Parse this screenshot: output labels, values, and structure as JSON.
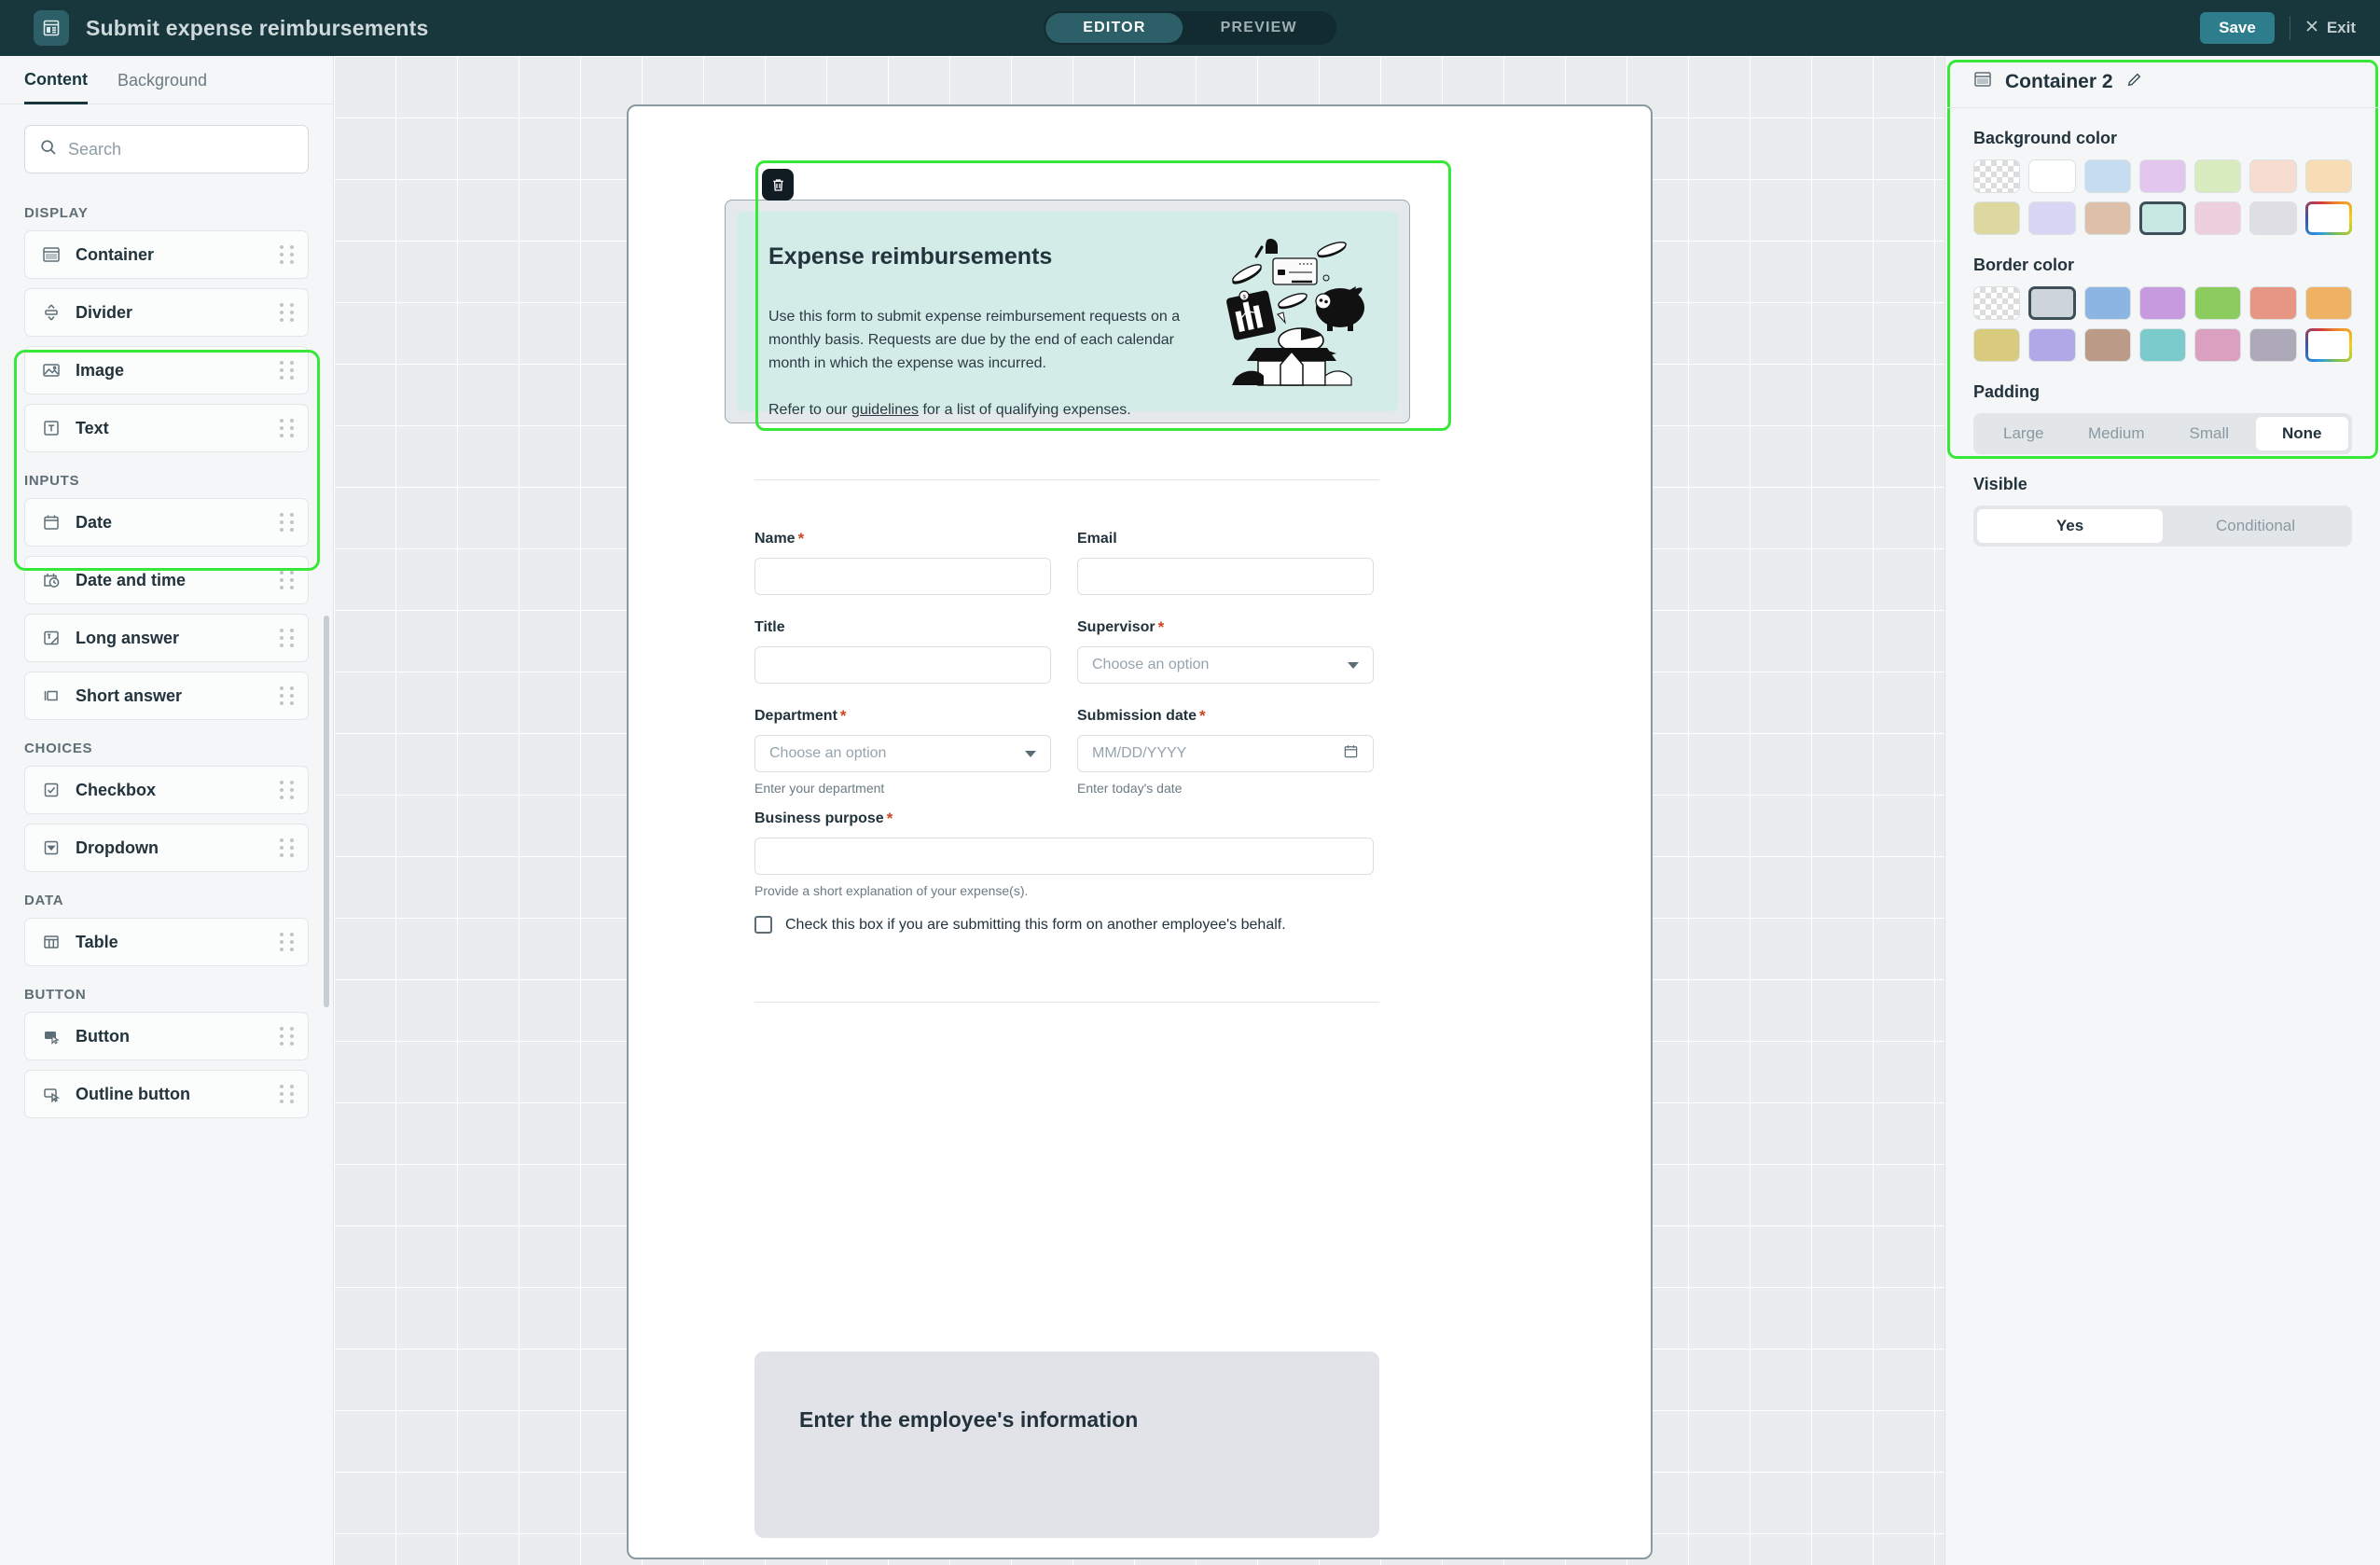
{
  "topbar": {
    "logo_icon": "form-layout-icon",
    "title": "Submit expense reimbursements",
    "mode_tabs": [
      {
        "label": "EDITOR",
        "active": true
      },
      {
        "label": "PREVIEW",
        "active": false
      }
    ],
    "save_label": "Save",
    "exit_label": "Exit",
    "accent": "#2d7d8c",
    "bar_bg": "#17373d"
  },
  "left_panel": {
    "tabs": [
      {
        "label": "Content",
        "active": true
      },
      {
        "label": "Background",
        "active": false
      }
    ],
    "search": {
      "placeholder": "Search",
      "value": "",
      "icon": "search-icon"
    },
    "groups": [
      {
        "label": "DISPLAY",
        "highlighted": true,
        "items": [
          {
            "label": "Container",
            "icon": "container-icon"
          },
          {
            "label": "Divider",
            "icon": "divider-icon"
          },
          {
            "label": "Image",
            "icon": "image-icon"
          },
          {
            "label": "Text",
            "icon": "text-icon"
          }
        ]
      },
      {
        "label": "INPUTS",
        "highlighted": false,
        "items": [
          {
            "label": "Date",
            "icon": "calendar-icon"
          },
          {
            "label": "Date and time",
            "icon": "calendar-clock-icon"
          },
          {
            "label": "Long answer",
            "icon": "long-answer-icon"
          },
          {
            "label": "Short answer",
            "icon": "short-answer-icon"
          }
        ]
      },
      {
        "label": "CHOICES",
        "highlighted": false,
        "items": [
          {
            "label": "Checkbox",
            "icon": "checkbox-icon"
          },
          {
            "label": "Dropdown",
            "icon": "dropdown-icon"
          }
        ]
      },
      {
        "label": "DATA",
        "highlighted": false,
        "items": [
          {
            "label": "Table",
            "icon": "table-icon"
          }
        ]
      },
      {
        "label": "BUTTON",
        "highlighted": false,
        "items": [
          {
            "label": "Button",
            "icon": "button-filled-icon"
          },
          {
            "label": "Outline button",
            "icon": "button-outline-icon"
          }
        ]
      }
    ]
  },
  "canvas": {
    "selected_component": "Container 2",
    "delete_icon": "trash-icon",
    "hero": {
      "heading": "Expense reimbursements",
      "paragraph_1": "Use this form to submit expense reimbursement requests on a monthly basis. Requests are due by the end of each calendar month in which the expense was incurred.",
      "paragraph_2_before": "Refer to our ",
      "paragraph_2_link": "guidelines",
      "paragraph_2_after": " for a list of qualifying expenses.",
      "bg_color": "#d3ece8",
      "illustration": "expenses-unboxing-illustration"
    },
    "fields": [
      {
        "label": "Name",
        "required": true,
        "type": "text",
        "value": "",
        "placeholder": "",
        "helper": ""
      },
      {
        "label": "Email",
        "required": false,
        "type": "text",
        "value": "",
        "placeholder": "",
        "helper": ""
      },
      {
        "label": "Title",
        "required": false,
        "type": "text",
        "value": "",
        "placeholder": "",
        "helper": ""
      },
      {
        "label": "Supervisor",
        "required": true,
        "type": "select",
        "value": "",
        "placeholder": "Choose an option",
        "helper": ""
      },
      {
        "label": "Department",
        "required": true,
        "type": "select",
        "value": "",
        "placeholder": "Choose an option",
        "helper": "Enter your department"
      },
      {
        "label": "Submission date",
        "required": true,
        "type": "date",
        "value": "",
        "placeholder": "MM/DD/YYYY",
        "helper": "Enter today's date"
      },
      {
        "label": "Business purpose",
        "required": true,
        "type": "text",
        "value": "",
        "placeholder": "",
        "helper": "Provide a short explanation of your expense(s)."
      }
    ],
    "checkbox": {
      "label": "Check this box if you are submitting this form on another employee's behalf.",
      "checked": false
    },
    "section_card": {
      "heading": "Enter the employee's information",
      "bg_color": "#e2e3e9"
    }
  },
  "right_panel": {
    "icon": "container-icon",
    "title": "Container 2",
    "edit_icon": "pencil-icon",
    "background_color": {
      "label": "Background color",
      "selected_index": 10,
      "swatches": [
        "transparent",
        "#ffffff",
        "#c5dcf1",
        "#e2c6ee",
        "#d9ecc0",
        "#f6ddd0",
        "#f7dcb6",
        "#ded7a0",
        "#d8d6f4",
        "#ddc0aa",
        "#c8e8e3",
        "#eed0dc",
        "#e0dee5",
        "custom"
      ]
    },
    "border_color": {
      "label": "Border color",
      "selected_index": 1,
      "swatches": [
        "transparent",
        "#cdd4da",
        "#8cb5e4",
        "#c79ae0",
        "#8ccb5e",
        "#e79683",
        "#efb163",
        "#d9cb7e",
        "#afa9e8",
        "#bb9b88",
        "#7ccbcc",
        "#dba0bf",
        "#ada9b9",
        "custom"
      ]
    },
    "padding": {
      "label": "Padding",
      "options": [
        "Large",
        "Medium",
        "Small",
        "None"
      ],
      "selected": "None"
    },
    "visible": {
      "label": "Visible",
      "options": [
        "Yes",
        "Conditional"
      ],
      "selected": "Yes"
    }
  },
  "colors": {
    "selection_ring": "#38e838",
    "required_asterisk": "#cf4520",
    "canvas_bg": "#eaedee"
  }
}
